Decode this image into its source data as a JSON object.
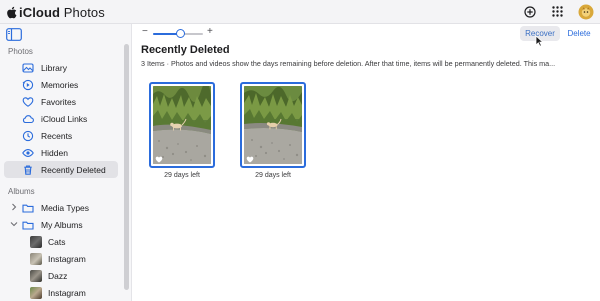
{
  "header": {
    "brand_title": "iCloud",
    "brand_suffix": " Photos",
    "icons": [
      "apple-logo-icon",
      "add-icon",
      "app-grid-icon",
      "avatar"
    ]
  },
  "sidebar": {
    "section_photos": "Photos",
    "items": [
      {
        "label": "Library",
        "icon": "library-icon"
      },
      {
        "label": "Memories",
        "icon": "memories-icon"
      },
      {
        "label": "Favorites",
        "icon": "heart-icon"
      },
      {
        "label": "iCloud Links",
        "icon": "cloud-link-icon"
      },
      {
        "label": "Recents",
        "icon": "clock-icon"
      },
      {
        "label": "Hidden",
        "icon": "eye-icon"
      },
      {
        "label": "Recently Deleted",
        "icon": "trash-icon",
        "active": true
      }
    ],
    "section_albums": "Albums",
    "groups": [
      {
        "label": "Media Types",
        "icon": "folder-icon",
        "expanded": false
      },
      {
        "label": "My Albums",
        "icon": "folder-icon",
        "expanded": true
      }
    ],
    "albums": [
      {
        "label": "Cats"
      },
      {
        "label": "Instagram"
      },
      {
        "label": "Dazz"
      },
      {
        "label": "Instagram"
      }
    ]
  },
  "toolbar": {
    "zoom_minus": "−",
    "zoom_plus": "+",
    "zoom_level": 0.55,
    "recover_label": "Recover",
    "delete_label": "Delete"
  },
  "main": {
    "title": "Recently Deleted",
    "subtitle": "3 Items  ·  Photos and videos show the days remaining before deletion. After that time, items will be permanently deleted. This ma...",
    "photos": [
      {
        "caption": "29 days left",
        "selected": true
      },
      {
        "caption": "29 days left",
        "selected": true
      }
    ]
  },
  "colors": {
    "accent": "#2b6cdc",
    "sidebar_bg": "#f6f6f8",
    "header_bg": "#f4f4f6",
    "selected_item_bg": "#e2e2e6"
  }
}
